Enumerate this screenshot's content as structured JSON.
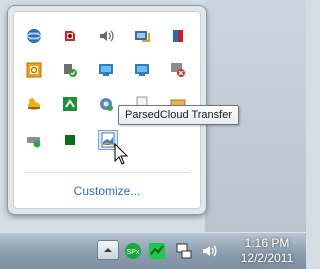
{
  "tray": {
    "customize_label": "Customize...",
    "tooltip_text": "ParsedCloud Transfer",
    "icons": [
      {
        "name": "network-globe-icon"
      },
      {
        "name": "audio-device-icon"
      },
      {
        "name": "speaker-icon"
      },
      {
        "name": "network-tray-icon"
      },
      {
        "name": "action-center-icon"
      },
      {
        "name": "outlook-icon"
      },
      {
        "name": "usb-device-ok-icon"
      },
      {
        "name": "display-icon"
      },
      {
        "name": "display-icon-2"
      },
      {
        "name": "display-error-icon"
      },
      {
        "name": "duck-app-icon"
      },
      {
        "name": "sync-green-icon"
      },
      {
        "name": "settings-sync-icon"
      },
      {
        "name": "document-icon"
      },
      {
        "name": "folder-icon"
      },
      {
        "name": "drive-check-icon"
      },
      {
        "name": "green-square-icon"
      },
      {
        "name": "parsedcloud-transfer-icon"
      }
    ]
  },
  "taskbar": {
    "time": "1:16 PM",
    "date": "12/2/2011",
    "sp_badge": "SPx"
  }
}
